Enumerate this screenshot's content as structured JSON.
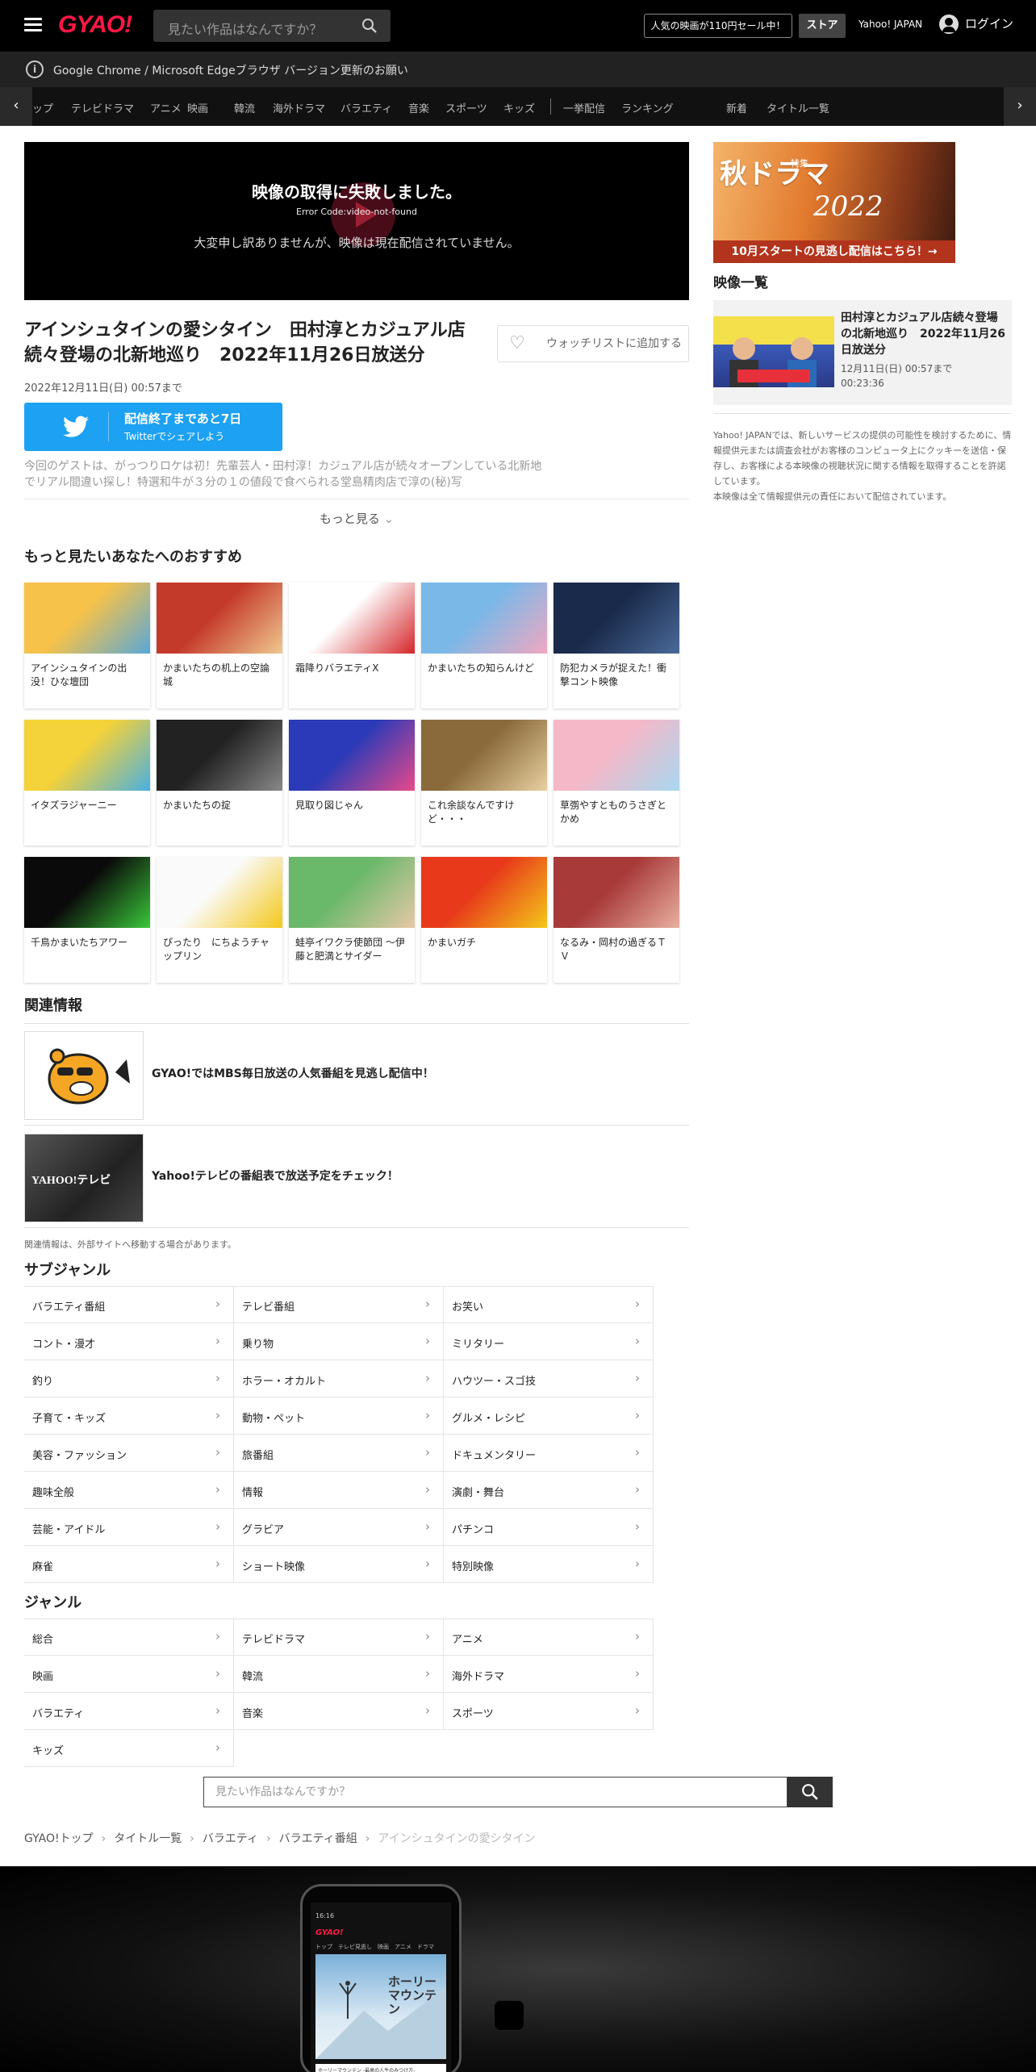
{
  "header": {
    "logo": "GYAO!",
    "search_placeholder": "見たい作品はなんですか？",
    "sale_label": "人気の映画が110円セール中！",
    "store_label": "ストア",
    "yahoo_label": "Yahoo! JAPAN",
    "login_label": "ログイン"
  },
  "notice": {
    "text": "Google Chrome / Microsoft Edgeブラウザ バージョン更新のお願い"
  },
  "nav": {
    "items": [
      "ップ",
      "テレビドラマ",
      "アニメ",
      "映画",
      "韓流",
      "海外ドラマ",
      "バラエティ",
      "音楽",
      "スポーツ",
      "キッズ",
      "一挙配信",
      "ランキング",
      "新着",
      "タイトル一覧"
    ]
  },
  "player": {
    "error_title": "映像の取得に失敗しました。",
    "error_code": "Error Code:video-not-found",
    "error_message": "大変申し訳ありませんが、映像は現在配信されていません。"
  },
  "episode": {
    "title": "アインシュタインの愛シタイン　田村淳とカジュアル店続々登場の北新地巡り　2022年11月26日放送分",
    "watchlist_label": "ウォッチリストに追加する",
    "expiry": "2022年12月11日(日) 00:57まで",
    "twitter_line1": "配信終了まであと7日",
    "twitter_line2": "Twitterでシェアしよう",
    "description": "今回のゲストは、がっつりロケは初！先輩芸人・田村淳！カジュアル店が続々オープンしている北新地でリアル間違い探し！特選和牛が３分の１の値段で食べられる堂島精肉店で淳の(秘)写",
    "more_label": "もっと見る"
  },
  "recommend": {
    "heading": "もっと見たいあなたへのおすすめ",
    "items": [
      {
        "title": "アインシュタインの出没！ひな壇団",
        "color1": "#f6c24a",
        "color2": "#58a8d8"
      },
      {
        "title": "かまいたちの机上の空論城",
        "color1": "#c43a2a",
        "color2": "#f0c890"
      },
      {
        "title": "霜降りバラエティX",
        "color1": "#ffffff",
        "color2": "#d4262a"
      },
      {
        "title": "かまいたちの知らんけど",
        "color1": "#7ab8e8",
        "color2": "#f0a8c0"
      },
      {
        "title": "防犯カメラが捉えた！衝撃コント映像",
        "color1": "#1a2a4a",
        "color2": "#4a6a9a"
      },
      {
        "title": "イタズラジャーニー",
        "color1": "#f4d23a",
        "color2": "#4ab0e0"
      },
      {
        "title": "かまいたちの掟",
        "color1": "#222222",
        "color2": "#888888"
      },
      {
        "title": "見取り図じゃん",
        "color1": "#2a3ab8",
        "color2": "#e84a8a"
      },
      {
        "title": "これ余談なんですけど・・・",
        "color1": "#8a6a3a",
        "color2": "#e8d0a0"
      },
      {
        "title": "草彅やすとものうさぎとかめ",
        "color1": "#f4b8c8",
        "color2": "#a8d8f0"
      },
      {
        "title": "千鳥かまいたちアワー",
        "color1": "#0a0a0a",
        "color2": "#3ac83a"
      },
      {
        "title": "ぴったり　にちようチャップリン",
        "color1": "#fafafa",
        "color2": "#f4c81a"
      },
      {
        "title": "蛙亭イワクラ使節団 ～伊藤と肥満とサイダー",
        "color1": "#6ab86a",
        "color2": "#e8c8a8"
      },
      {
        "title": "かまいガチ",
        "color1": "#e83a1a",
        "color2": "#f4c81a"
      },
      {
        "title": "なるみ・岡村の過ぎるＴＶ",
        "color1": "#a83a3a",
        "color2": "#e8b0a0"
      }
    ]
  },
  "related": {
    "heading": "関連情報",
    "items": [
      {
        "text": "GYAO!ではMBS毎日放送の人気番組を見逃し配信中！"
      },
      {
        "text": "Yahoo!テレビの番組表で放送予定をチェック！",
        "img_text": "YAHOO!テレビ"
      }
    ],
    "note": "関連情報は、外部サイトへ移動する場合があります。"
  },
  "subgenre": {
    "heading": "サブジャンル",
    "items": [
      "バラエティ番組",
      "テレビ番組",
      "お笑い",
      "コント・漫才",
      "乗り物",
      "ミリタリー",
      "釣り",
      "ホラー・オカルト",
      "ハウツー・スゴ技",
      "子育て・キッズ",
      "動物・ペット",
      "グルメ・レシピ",
      "美容・ファッション",
      "旅番組",
      "ドキュメンタリー",
      "趣味全般",
      "情報",
      "演劇・舞台",
      "芸能・アイドル",
      "グラビア",
      "パチンコ",
      "麻雀",
      "ショート映像",
      "特別映像"
    ]
  },
  "genre": {
    "heading": "ジャンル",
    "items": [
      "総合",
      "テレビドラマ",
      "アニメ",
      "映画",
      "韓流",
      "海外ドラマ",
      "バラエティ",
      "音楽",
      "スポーツ",
      "キッズ"
    ]
  },
  "bottom_search": {
    "placeholder": "見たい作品はなんですか？"
  },
  "breadcrumb": [
    "GYAO!トップ",
    "タイトル一覧",
    "バラエティ",
    "バラエティ番組",
    "アインシュタインの愛シタイン"
  ],
  "sidebar": {
    "banner_big": "秋ドラマ",
    "banner_sub": "特集",
    "banner_year": "2022",
    "banner_bar": "10月スタートの見逃し配信はこちら！→",
    "list_heading": "映像一覧",
    "card_title": "田村淳とカジュアル店続々登場の北新地巡り　2022年11月26日放送分",
    "card_expiry": "12月11日(日) 00:57まで",
    "card_duration": "00:23:36",
    "note": "Yahoo! JAPANでは、新しいサービスの提供の可能性を検討するために、情報提供元または調査会社がお客様のコンピュータ上にクッキーを送信・保存し、お客様による本映像の視聴状況に関する情報を取得することを許諾しています。\n本映像は全て情報提供元の責任において配信されています。"
  },
  "footer": {
    "phone_time": "16:16",
    "phone_logo": "GYAO!",
    "phone_tabs": "トップ　テレビ見逃し　映画　アニメ　ドラマ",
    "phone_poster_title": "ホーリー\nマウンテン",
    "phone_caption": "ホーリーマウンテン -最高の人生のみつけ方-"
  },
  "colors": {
    "accent": "#ff1744",
    "twitter": "#1da1f2",
    "header_bg": "#000000"
  }
}
